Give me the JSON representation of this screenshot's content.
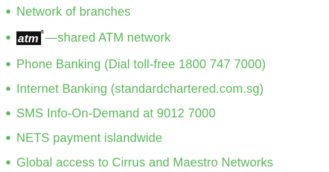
{
  "colors": {
    "accent_green": "#5cb85c",
    "logo_black": "#111111"
  },
  "features": {
    "items": [
      {
        "kind": "text",
        "text": "Network of branches"
      },
      {
        "kind": "logo",
        "logo_text": "atm",
        "logo_sup": "5",
        "text": "—shared ATM network"
      },
      {
        "kind": "text",
        "text": "Phone Banking (Dial toll-free 1800 747 7000)"
      },
      {
        "kind": "text",
        "text": "Internet Banking (standardchartered.com.sg)"
      },
      {
        "kind": "text",
        "text": "SMS Info-On-Demand at 9012 7000"
      },
      {
        "kind": "text",
        "text": "NETS payment islandwide"
      },
      {
        "kind": "text",
        "text": "Global access to Cirrus and Maestro Networks"
      }
    ]
  }
}
